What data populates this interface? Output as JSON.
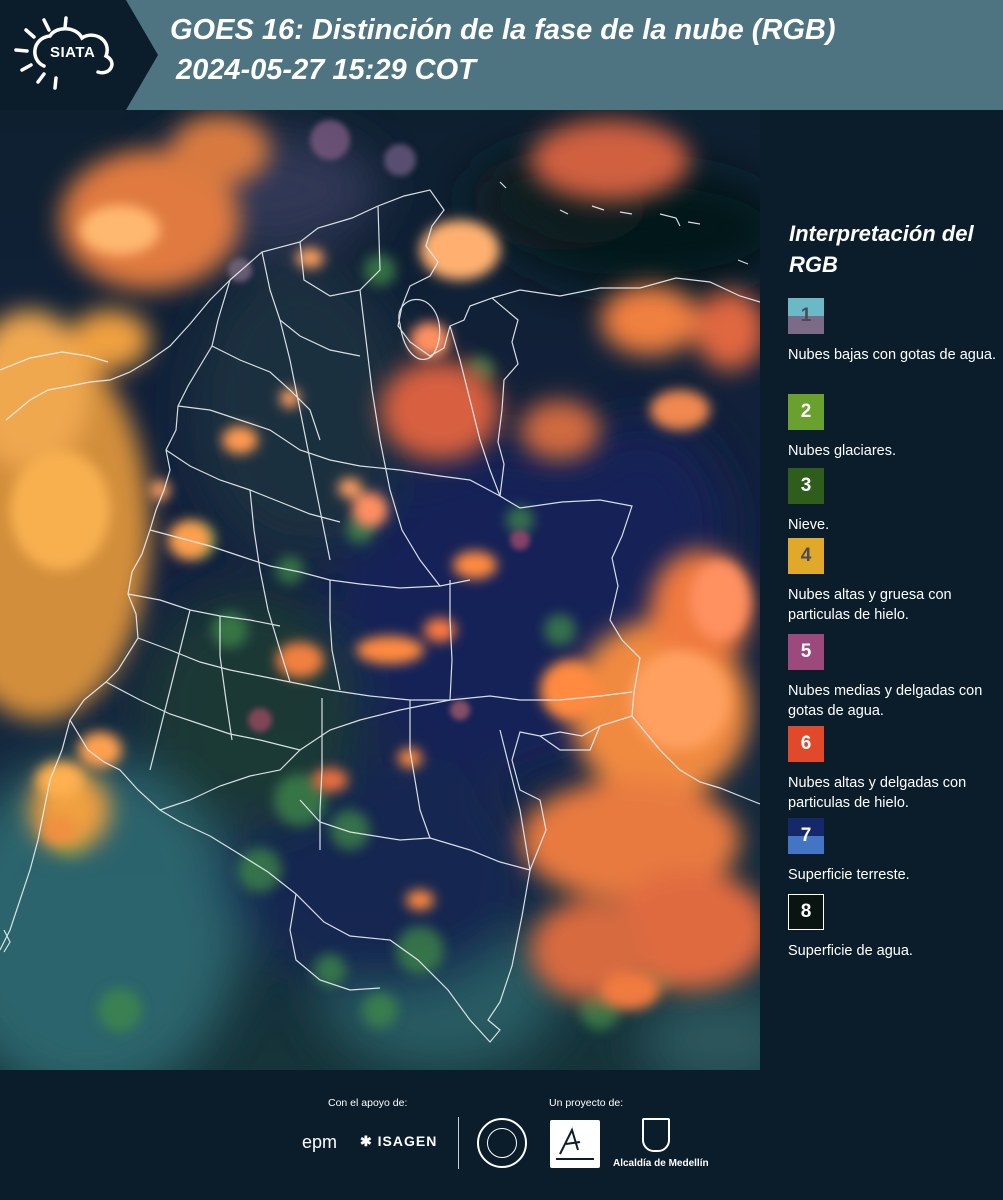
{
  "header": {
    "logo_text": "SIATA",
    "title_line1": "GOES 16: Distinción de la fase de la nube (RGB)",
    "title_line2": "2024-05-27 15:29 COT",
    "background_color": "#4e7482"
  },
  "legend": {
    "title": "Interpretación del RGB",
    "items": [
      {
        "number": "1",
        "label": "Nubes bajas con gotas de agua.",
        "colors": [
          "#6ab9c4",
          "#7b6a88"
        ]
      },
      {
        "number": "2",
        "label": "Nubes glaciares.",
        "colors": [
          "#6aa02e"
        ]
      },
      {
        "number": "3",
        "label": "Nieve.",
        "colors": [
          "#2f5e1c"
        ]
      },
      {
        "number": "4",
        "label": "Nubes altas y gruesa con particulas de hielo.",
        "colors": [
          "#e0a92a"
        ]
      },
      {
        "number": "5",
        "label": "Nubes medias y delgadas con gotas de agua.",
        "colors": [
          "#9c4a7e"
        ]
      },
      {
        "number": "6",
        "label": "Nubes altas y delgadas con particulas de hielo.",
        "colors": [
          "#e04a2a"
        ]
      },
      {
        "number": "7",
        "label": "Superficie terreste.",
        "colors": [
          "#14286a",
          "#4474c4"
        ]
      },
      {
        "number": "8",
        "label": "Superficie de agua.",
        "colors": [
          "#0a1410"
        ]
      }
    ]
  },
  "footer": {
    "support_label": "Con el apoyo de:",
    "project_label": "Un proyecto de:",
    "sponsor_1": "epm",
    "sponsor_2": "ISAGEN",
    "partner_3": "Alcaldía de Medellín"
  },
  "icons": [
    "sun-cloud-logo-icon",
    "epm-logo-icon",
    "isagen-logo-icon",
    "seal-icon",
    "area-metropolitana-logo-icon",
    "shield-icon"
  ]
}
